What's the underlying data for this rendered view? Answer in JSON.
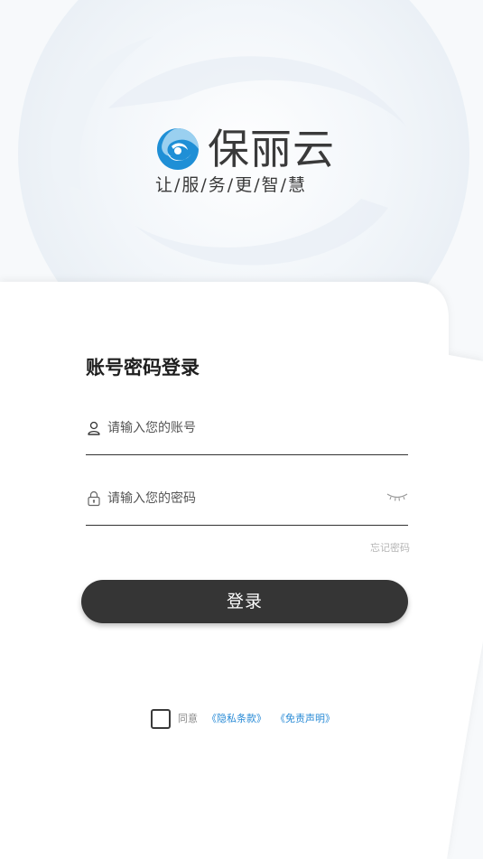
{
  "brand": {
    "name": "保丽云",
    "slogan": "让/服/务/更/智/慧",
    "logo_colors": [
      "#1f8fd6",
      "#9ad0f0"
    ]
  },
  "login": {
    "title": "账号密码登录",
    "username": {
      "placeholder": "请输入您的账号",
      "value": "",
      "icon": "user-icon"
    },
    "password": {
      "placeholder": "请输入您的密码",
      "value": "",
      "icon": "lock-icon",
      "toggle_icon": "eye-closed-icon"
    },
    "forgot_label": "忘记密码",
    "submit_label": "登录"
  },
  "agreement": {
    "checked": false,
    "prefix": "同意",
    "privacy_label": "《隐私条款》",
    "disclaimer_label": "《免责声明》"
  },
  "colors": {
    "button_bg": "#353535",
    "link": "#2a8bd6",
    "page_bg": "#f4f6f9"
  }
}
